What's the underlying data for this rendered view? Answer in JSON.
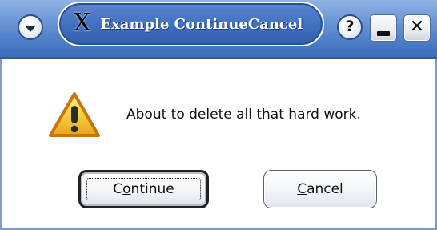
{
  "window": {
    "title": "Example ContinueCancel",
    "logo_glyph": "X"
  },
  "titlebar": {
    "menu_icon": "chevron-down-icon",
    "help_label": "?",
    "minimize_icon": "minimize-icon",
    "close_label": "✕"
  },
  "dialog": {
    "message": "About to delete all that hard work.",
    "icon": "warning-icon",
    "buttons": {
      "continue_prefix": "C",
      "continue_mnemonic": "o",
      "continue_suffix": "ntinue",
      "cancel_mnemonic": "C",
      "cancel_suffix": "ancel"
    }
  },
  "colors": {
    "titlebar_blue": "#4f7fc8",
    "warning_yellow": "#f2c318",
    "warning_outline": "#c77411"
  }
}
